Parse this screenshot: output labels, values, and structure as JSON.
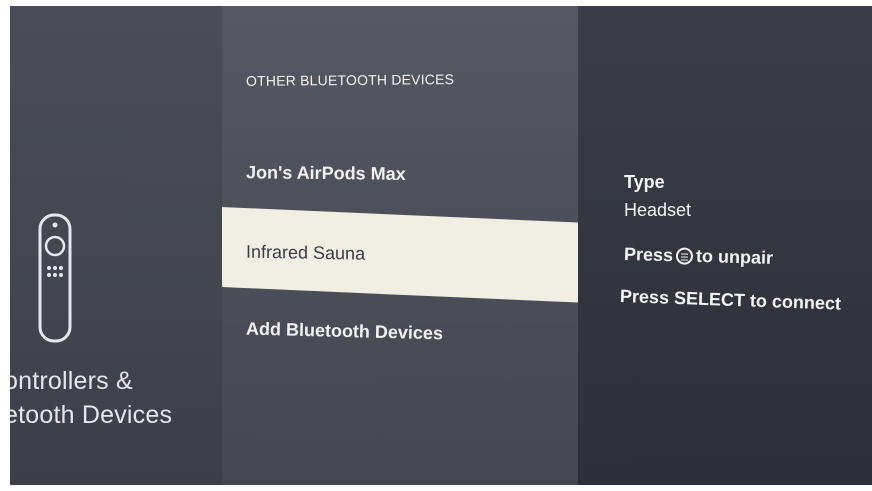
{
  "left_panel": {
    "title_line1": "ontrollers &",
    "title_line2": "etooth Devices",
    "icon": "fire-tv-remote-icon"
  },
  "middle_panel": {
    "section_heading": "OTHER BLUETOOTH DEVICES",
    "items": [
      {
        "label": "Jon's AirPods Max",
        "selected": false
      },
      {
        "label": "Infrared Sauna",
        "selected": true
      },
      {
        "label": "Add Bluetooth Devices",
        "selected": false
      }
    ]
  },
  "right_panel": {
    "type_label": "Type",
    "type_value": "Headset",
    "unpair_prefix": "Press",
    "unpair_suffix": "to unpair",
    "unpair_icon": "menu-button-icon",
    "connect_hint": "Press SELECT to connect"
  },
  "colors": {
    "selected_background": "#f1efe4",
    "selected_text": "#3a3c42",
    "text": "#f1f1f3"
  }
}
